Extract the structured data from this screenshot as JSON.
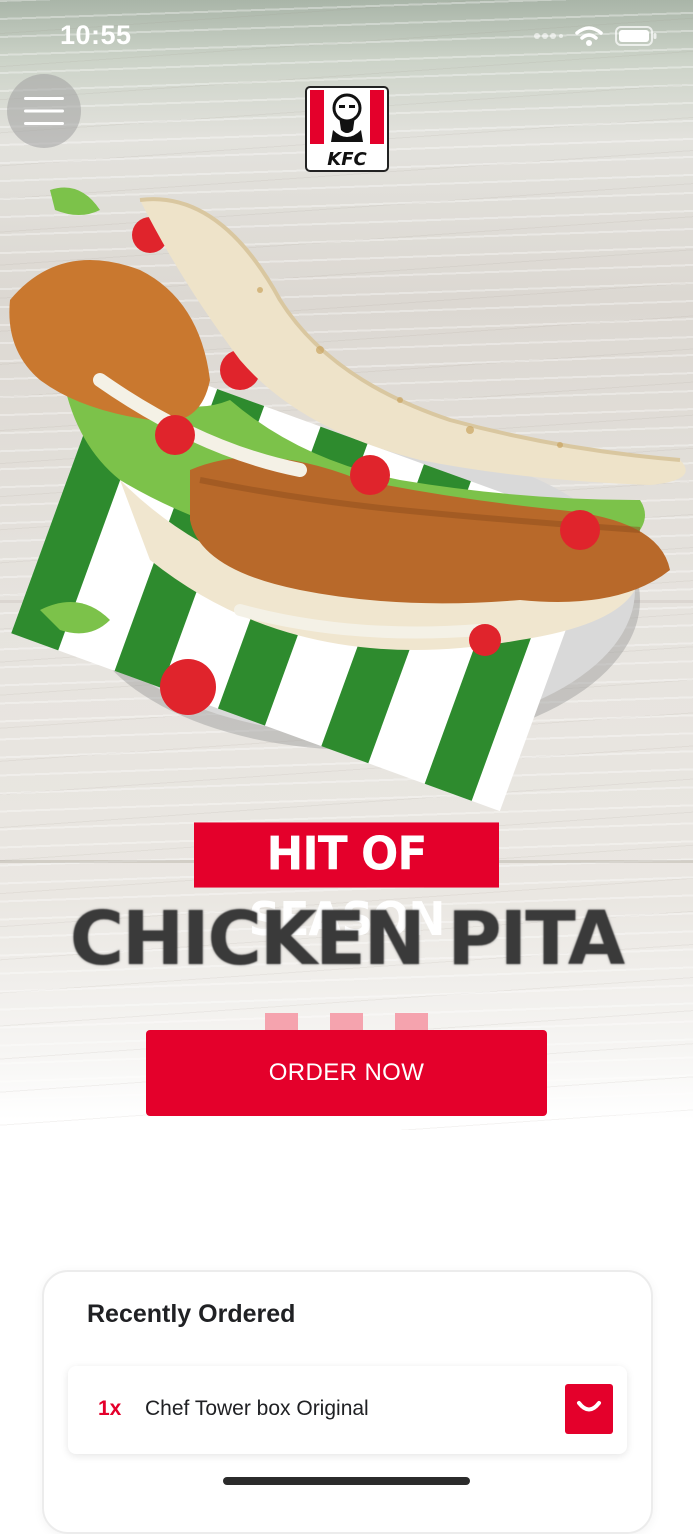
{
  "status_bar": {
    "time": "10:55"
  },
  "header": {
    "menu_icon": "hamburger-icon",
    "logo_text": "KFC"
  },
  "hero": {
    "tag": "HIT OF SEASON",
    "title": "CHICKEN PITA",
    "cta_label": "ORDER NOW"
  },
  "recent": {
    "title": "Recently Ordered",
    "items": [
      {
        "qty": "1x",
        "name": "Chef Tower box Original",
        "action_icon": "shopping-bag-icon"
      }
    ]
  },
  "colors": {
    "brand_red": "#e4002b",
    "text_dark": "#202124",
    "status_text": "#ffffff"
  }
}
